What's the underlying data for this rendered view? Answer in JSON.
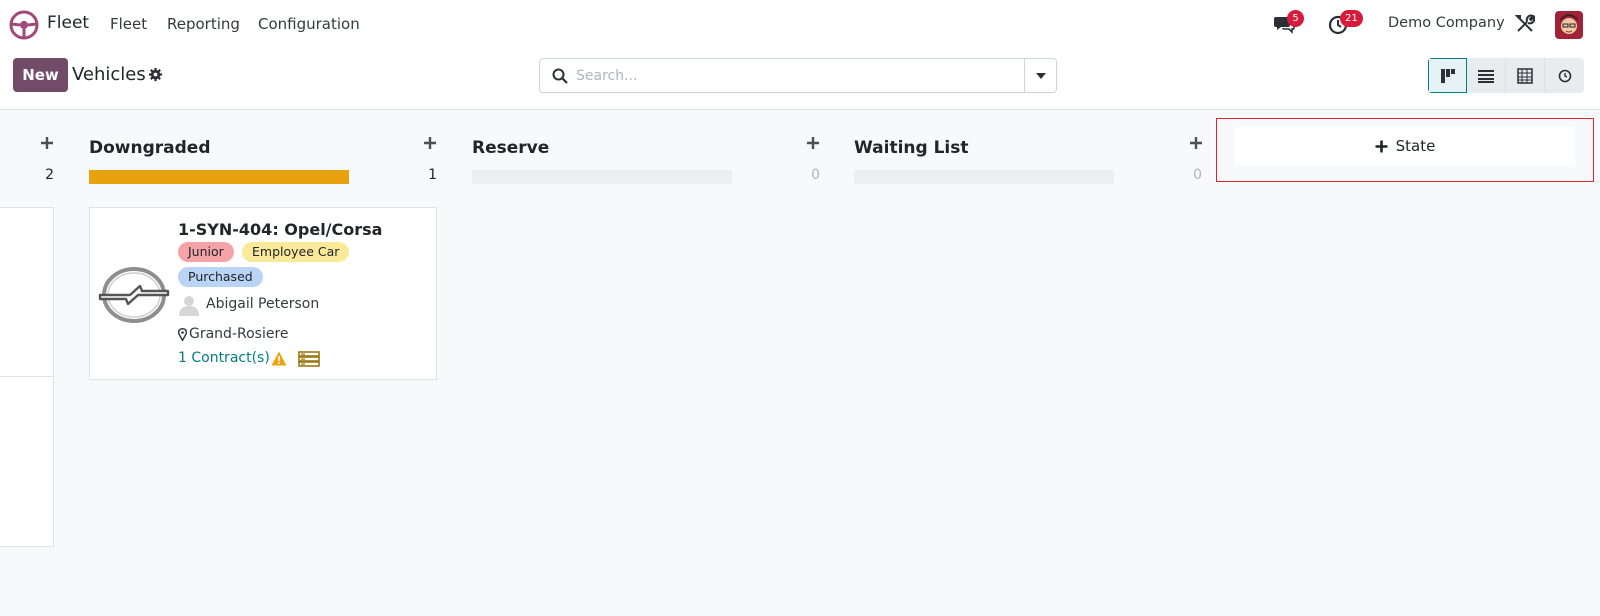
{
  "navbar": {
    "app_name": "Fleet",
    "menu": [
      "Fleet",
      "Reporting",
      "Configuration"
    ],
    "messages_count": "5",
    "activities_count": "21",
    "company": "Demo Company"
  },
  "control_panel": {
    "new_label": "New",
    "title": "Vehicles",
    "search_placeholder": "Search..."
  },
  "columns": [
    {
      "name": "",
      "count": "2"
    },
    {
      "name": "Downgraded",
      "count": "1",
      "progress": 1.0
    },
    {
      "name": "Reserve",
      "count": "0",
      "progress": 0
    },
    {
      "name": "Waiting List",
      "count": "0",
      "progress": 0
    }
  ],
  "card": {
    "title": "1-SYN-404: Opel/Corsa",
    "tags": [
      {
        "label": "Junior",
        "color": "#f5a3a8"
      },
      {
        "label": "Employee Car",
        "color": "#fbe99a"
      },
      {
        "label": "Purchased",
        "color": "#b9d4f5"
      }
    ],
    "driver": "Abigail Peterson",
    "location": "Grand-Rosiere",
    "contracts": "1 Contract(s)"
  },
  "add_state_label": "State",
  "colors": {
    "brand": "#714b67",
    "accent": "#017e84",
    "progress": "#e8a20f",
    "badge": "#d81b3a"
  }
}
